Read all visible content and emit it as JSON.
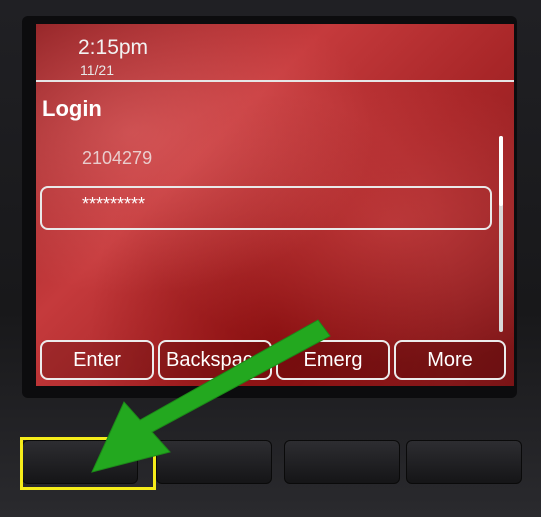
{
  "status": {
    "time": "2:15pm",
    "date": "11/21"
  },
  "login": {
    "title": "Login",
    "user_id": "2104279",
    "password_mask": "*********"
  },
  "softkeys": [
    {
      "label": "Enter"
    },
    {
      "label": "Backspace"
    },
    {
      "label": "Emerg"
    },
    {
      "label": "More"
    }
  ],
  "annotation": {
    "highlight_color": "#f5ec1a",
    "arrow_color": "#23a81f"
  },
  "colors": {
    "screen_red": "#b52e30",
    "text": "#ffffff"
  }
}
